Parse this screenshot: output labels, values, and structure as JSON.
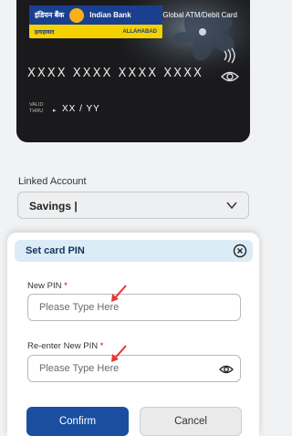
{
  "card": {
    "bank_hindi": "इंडियन बैंक",
    "bank_name": "Indian Bank",
    "sub_left": "इलाहाबाद",
    "sub_right": "ALLAHABAD",
    "card_type": "Global ATM/Debit Card",
    "number": "XXXX XXXX XXXX XXXX",
    "valid_thru_label_1": "VALID",
    "valid_thru_label_2": "THRU",
    "valid_thru_value": "XX / YY"
  },
  "linked_account": {
    "label": "Linked Account",
    "value": "Savings |"
  },
  "sheet": {
    "title": "Set card PIN",
    "new_pin_label": "New PIN",
    "reenter_pin_label": "Re-enter New PIN",
    "required_mark": "*",
    "new_pin_placeholder": "Please Type Here",
    "reenter_pin_placeholder": "Please Type Here",
    "confirm_label": "Confirm",
    "cancel_label": "Cancel"
  },
  "colors": {
    "primary": "#1a4fa0",
    "header_bg": "#dcecf7",
    "annotation_arrow": "#e53935"
  },
  "icons": [
    "nfc-icon",
    "eye-icon",
    "chevron-down-icon",
    "close-icon",
    "arrow-icon"
  ]
}
